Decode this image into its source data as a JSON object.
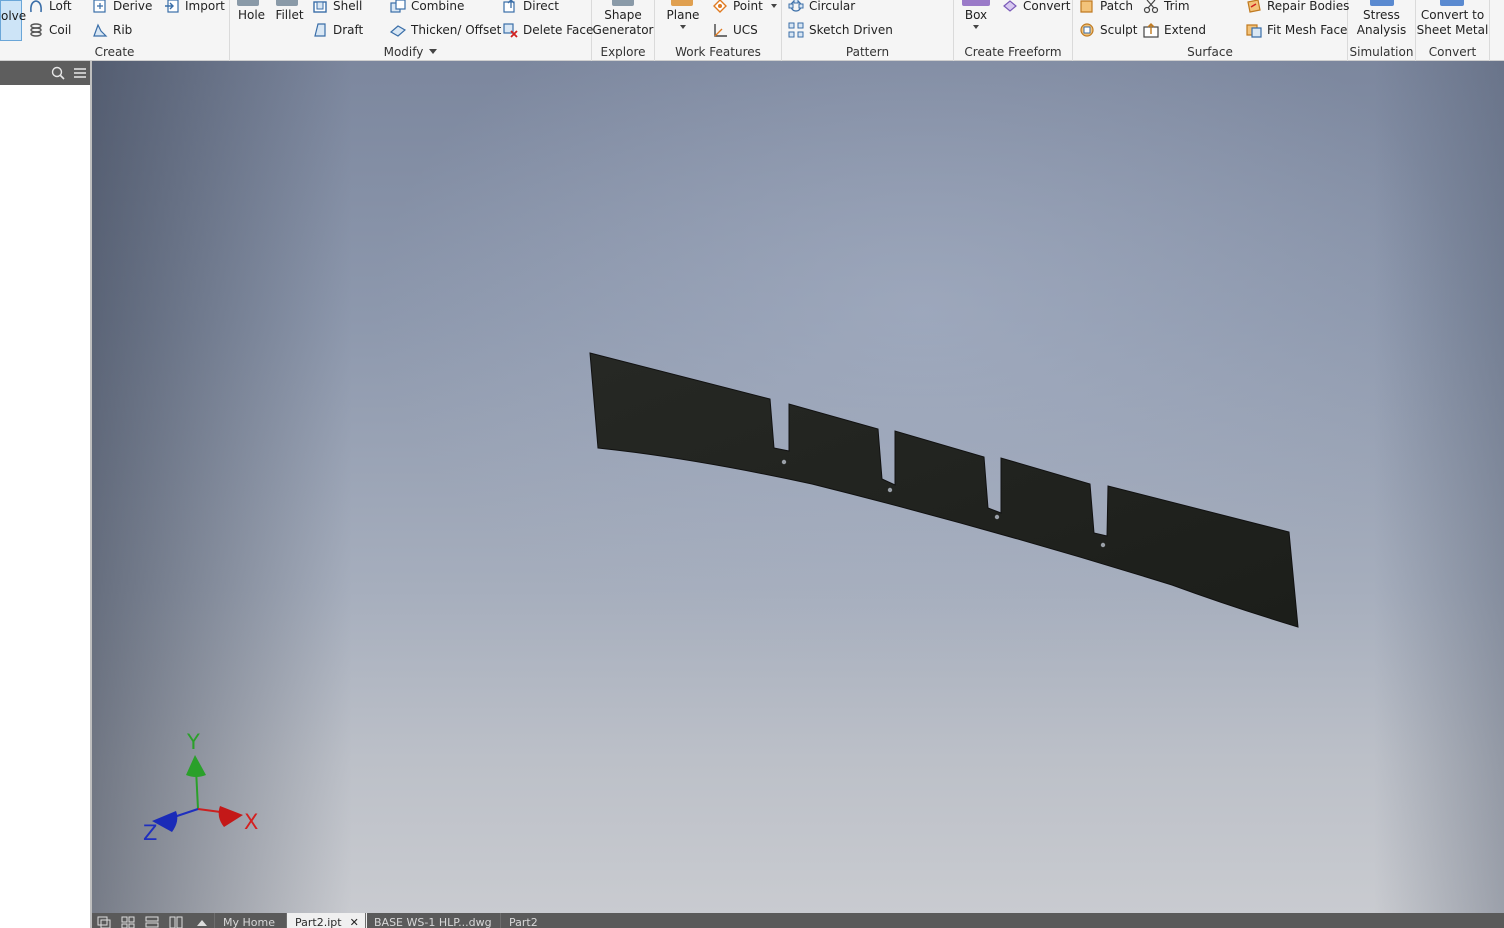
{
  "ribbon": {
    "create": {
      "label": "Create",
      "revolve": "olve",
      "loft": "Loft",
      "coil": "Coil",
      "derive": "Derive",
      "rib": "Rib",
      "import": "Import"
    },
    "modify": {
      "label": "Modify",
      "hole": "Hole",
      "fillet": "Fillet",
      "shell": "Shell",
      "draft": "Draft",
      "combine": "Combine",
      "thicken": "Thicken/ Offset",
      "direct": "Direct",
      "delete_face": "Delete Face"
    },
    "explore": {
      "label": "Explore",
      "shape_generator_line1": "Shape",
      "shape_generator_line2": "Generator"
    },
    "work_features": {
      "label": "Work Features",
      "plane": "Plane",
      "point": "Point",
      "ucs": "UCS"
    },
    "pattern": {
      "label": "Pattern",
      "circular": "Circular",
      "sketch_driven": "Sketch Driven"
    },
    "create_freeform": {
      "label": "Create Freeform",
      "box": "Box",
      "convert": "Convert"
    },
    "surface": {
      "label": "Surface",
      "patch": "Patch",
      "sculpt": "Sculpt",
      "trim": "Trim",
      "extend": "Extend",
      "repair_bodies": "Repair Bodies",
      "fit_mesh_face": "Fit Mesh Face"
    },
    "simulation": {
      "label": "Simulation",
      "stress_line1": "Stress",
      "stress_line2": "Analysis"
    },
    "convert": {
      "label": "Convert",
      "sheet_line1": "Convert to",
      "sheet_line2": "Sheet Metal"
    }
  },
  "viewport": {
    "triad": {
      "x": "X",
      "y": "Y",
      "z": "Z"
    },
    "colors": {
      "part": "#222420",
      "x_axis": "#d42020",
      "y_axis": "#2aa02a",
      "z_axis": "#1f2fbf"
    }
  },
  "doc_tabs": [
    {
      "label": "My Home"
    },
    {
      "label": "Part2.ipt"
    },
    {
      "label": "BASE WS-1 HLP...dwg"
    },
    {
      "label": "Part2"
    }
  ]
}
